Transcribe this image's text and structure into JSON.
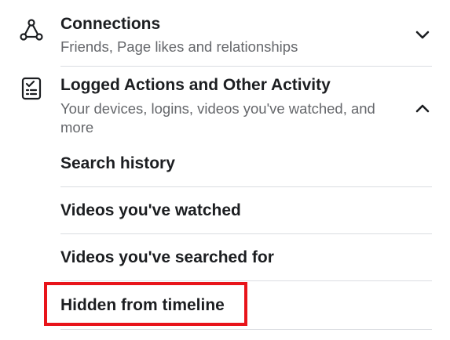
{
  "connections": {
    "title": "Connections",
    "subtitle": "Friends, Page likes and relationships",
    "icon": "connections-icon",
    "chevron": "chevron-down-icon"
  },
  "logged_actions": {
    "title": "Logged Actions and Other Activity",
    "subtitle": "Your devices, logins, videos you've watched, and more",
    "icon": "checklist-icon",
    "chevron": "chevron-up-icon",
    "items": [
      {
        "label": "Search history"
      },
      {
        "label": "Videos you've watched"
      },
      {
        "label": "Videos you've searched for"
      },
      {
        "label": "Hidden from timeline"
      }
    ]
  },
  "highlight": {
    "color": "#e8141a",
    "target": "Hidden from timeline"
  }
}
